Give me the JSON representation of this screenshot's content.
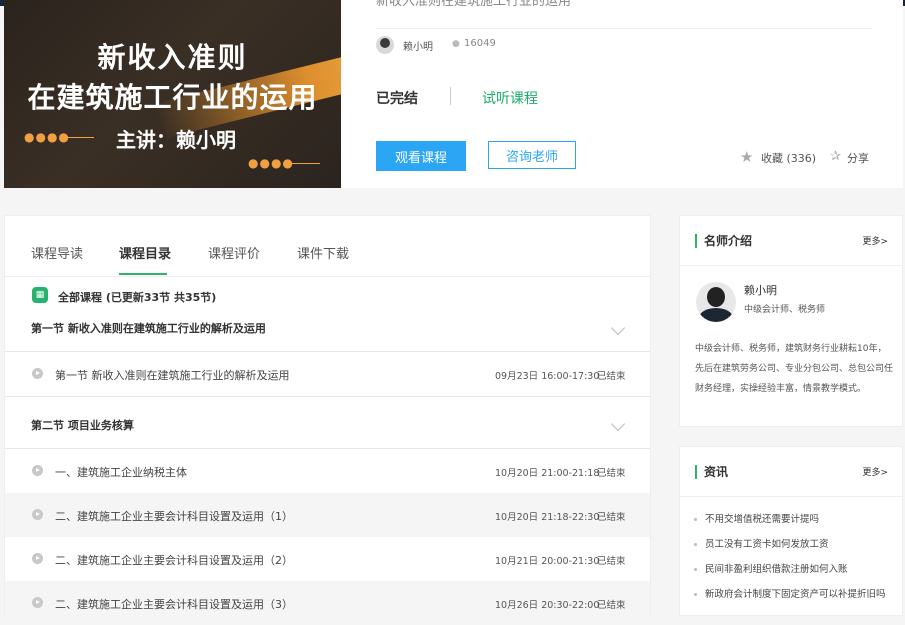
{
  "course": {
    "cover": {
      "title_line1": "新收入准则",
      "title_line2": "在建筑施工行业的运用",
      "lecturer": "主讲：赖小明",
      "dots": "●●●●"
    },
    "title": "新收入准则在建筑施工行业的运用",
    "teacher": "赖小明",
    "views": "16049",
    "status": "已完结",
    "trial_link": "试听课程",
    "watch_button": "观看课程",
    "consult_button": "咨询老师",
    "favorite": "收藏 (336)",
    "share": "分享"
  },
  "tabs": [
    "课程导读",
    "课程目录",
    "课程评价",
    "课件下载"
  ],
  "catalog": {
    "all_title": "全部课程  (已更新33节 共35节)",
    "book_icon": "book-icon",
    "sections": [
      {
        "title": "第一节 新收入准则在建筑施工行业的解析及运用",
        "lessons": [
          {
            "title": "第一节 新收入准则在建筑施工行业的解析及运用",
            "time": "09月23日 16:00-17:30",
            "status": "已结束"
          }
        ]
      },
      {
        "title": "第二节 项目业务核算",
        "lessons": [
          {
            "title": "一、建筑施工企业纳税主体",
            "time": "10月20日 21:00-21:18",
            "status": "已结束"
          },
          {
            "title": "二、建筑施工企业主要会计科目设置及运用（1）",
            "time": "10月20日 21:18-22:30",
            "status": "已结束"
          },
          {
            "title": "二、建筑施工企业主要会计科目设置及运用（2）",
            "time": "10月21日 20:00-21:30",
            "status": "已结束"
          },
          {
            "title": "二、建筑施工企业主要会计科目设置及运用（3）",
            "time": "10月26日 20:30-22:00",
            "status": "已结束"
          }
        ]
      }
    ]
  },
  "teacher_panel": {
    "title": "名师介绍",
    "more": "更多>",
    "name": "赖小明",
    "titles": "中级会计师、税务师",
    "description": "中级会计师、税务师，建筑财务行业耕耘10年，先后在建筑劳务公司、专业分包公司、总包公司任财务经理，实操经验丰富，情景教学模式。"
  },
  "news_panel": {
    "title": "资讯",
    "more": "更多>",
    "items": [
      "不用交增值税还需要计提吗",
      "员工没有工资卡如何发放工资",
      "民间非盈利组织借款注册如何入账",
      "新政府会计制度下固定资产可以补提折旧吗"
    ]
  },
  "colors": {
    "accent_green": "#2db36b",
    "primary_blue": "#2ba6f5",
    "topbar": "#14263f"
  }
}
